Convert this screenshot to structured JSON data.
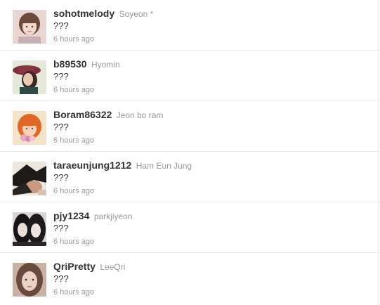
{
  "feed": {
    "items": [
      {
        "screen_name": "sohotmelody",
        "real_name": "Soyeon *",
        "text": "???",
        "time": "6 hours ago"
      },
      {
        "screen_name": "b89530",
        "real_name": "Hyomin",
        "text": "???",
        "time": "6 hours ago"
      },
      {
        "screen_name": "Boram86322",
        "real_name": "Jeon bo ram",
        "text": "???",
        "time": "6 hours ago"
      },
      {
        "screen_name": "taraeunjung1212",
        "real_name": "Ham Eun Jung",
        "text": "???",
        "time": "6 hours ago"
      },
      {
        "screen_name": "pjy1234",
        "real_name": "parkjiyeon",
        "text": "???",
        "time": "6 hours ago"
      },
      {
        "screen_name": "QriPretty",
        "real_name": "LeeQri",
        "text": "???",
        "time": "6 hours ago"
      }
    ]
  },
  "colors": {
    "screen_name": "#333333",
    "muted": "#999999",
    "divider": "#e8e8e8"
  }
}
